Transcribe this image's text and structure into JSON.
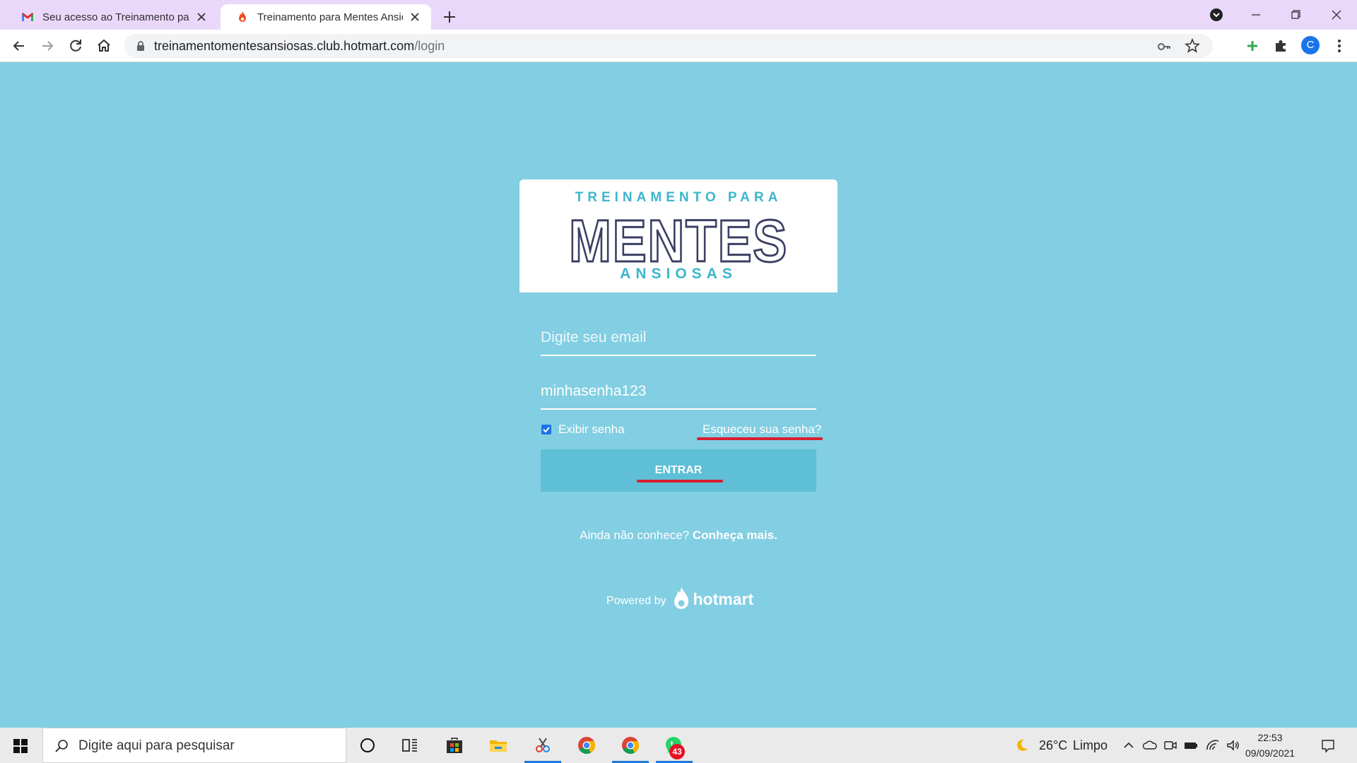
{
  "browser": {
    "tabs": [
      {
        "title": "Seu acesso ao Treinamento para Mentes Ansiosas",
        "icon": "gmail-icon"
      },
      {
        "title": "Treinamento para Mentes Ansiosas",
        "icon": "hotmart-flame-icon"
      }
    ],
    "url_host": "treinamentomentesansiosas.club.hotmart.com",
    "url_path": "/login",
    "profile_initial": "C"
  },
  "logo": {
    "top_text": "TREINAMENTO PARA",
    "main_text": "MENTES",
    "bottom_text": "ANSIOSAS",
    "colors": {
      "accent": "#3cb6cd",
      "outline": "#3b3f63"
    }
  },
  "form": {
    "email_placeholder": "Digite seu email",
    "email_value": "",
    "password_value": "minhasenha123",
    "show_password_label": "Exibir senha",
    "show_password_checked": true,
    "forgot_password": "Esqueceu sua senha?",
    "submit_label": "ENTRAR"
  },
  "promo": {
    "text": "Ainda não conhece?",
    "link": "Conheça mais."
  },
  "footer": {
    "powered_by": "Powered by",
    "brand": "hotmart"
  },
  "taskbar": {
    "search_placeholder": "Digite aqui para pesquisar",
    "whatsapp_badge": "43",
    "weather_temp": "26°C",
    "weather_desc": "Limpo",
    "time": "22:53",
    "date": "09/09/2021"
  },
  "colors": {
    "page_bg": "#82cee2",
    "button_bg": "#5ebfd6",
    "annotation_red": "#d81e2d",
    "tabstrip_bg": "#ead8fb"
  }
}
